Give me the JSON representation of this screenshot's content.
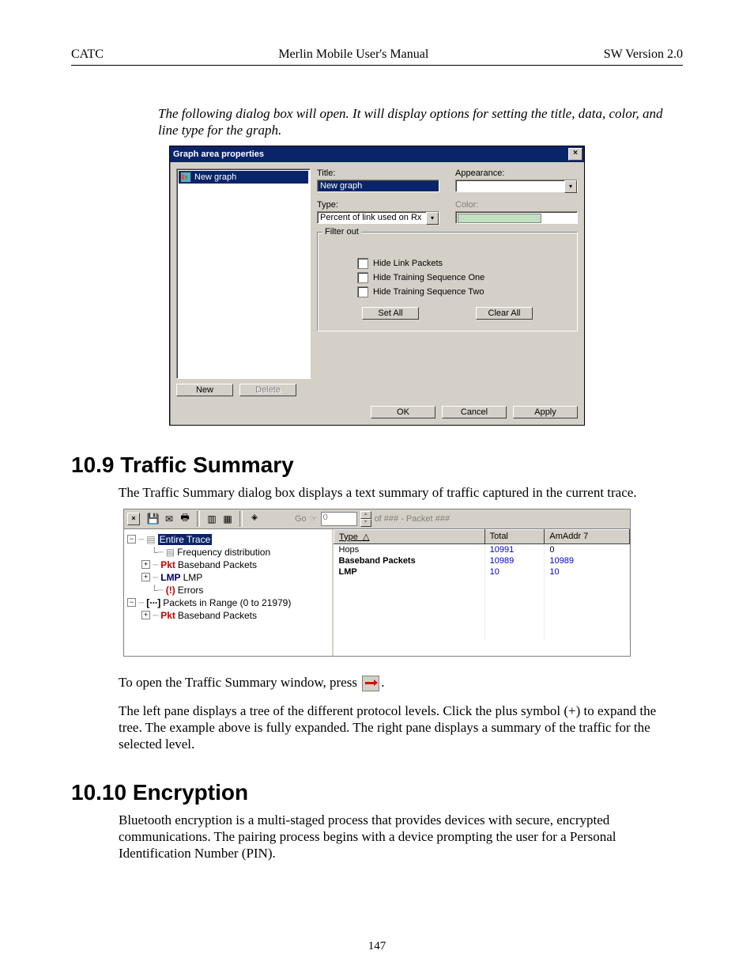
{
  "header": {
    "left": "CATC",
    "center": "Merlin Mobile User's Manual",
    "right": "SW Version 2.0"
  },
  "intro": "The following dialog box will open.  It will display options for setting the title, data, color, and line type for the graph.",
  "dlg1": {
    "title": "Graph area properties",
    "listItem": "New graph",
    "newBtn": "New",
    "deleteBtn": "Delete",
    "titleLbl": "Title:",
    "titleVal": "New graph",
    "appearanceLbl": "Appearance:",
    "typeLbl": "Type:",
    "typeVal": "Percent of link used on Rx",
    "colorLbl": "Color:",
    "filterLbl": "Filter out",
    "chk1": "Hide Link Packets",
    "chk2": "Hide Training Sequence One",
    "chk3": "Hide Training Sequence Two",
    "setAll": "Set All",
    "clearAll": "Clear All",
    "ok": "OK",
    "cancel": "Cancel",
    "apply": "Apply"
  },
  "sec1": {
    "heading": "10.9  Traffic Summary",
    "p1": "The Traffic Summary dialog box displays a text summary of traffic captured in the current trace."
  },
  "dlg2": {
    "go": "Go",
    "goVal": "0",
    "goRight": "of ### - Packet ###",
    "col1": "Type",
    "col2": "Total",
    "col3": "AmAddr 7",
    "rows": [
      {
        "type": "Hops",
        "total": "10991",
        "am": "0",
        "bold": false
      },
      {
        "type": "Baseband Packets",
        "total": "10989",
        "am": "10989",
        "bold": true
      },
      {
        "type": "LMP",
        "total": "10",
        "am": "10",
        "bold": true
      }
    ],
    "tree": {
      "root": "Entire Trace",
      "freq": "Frequency distribution",
      "bbp": "Baseband Packets",
      "lmp": "LMP",
      "err": "Errors",
      "range": "Packets in Range (0 to 21979)",
      "bbp2": "Baseband Packets",
      "pktTag": "Pkt",
      "lmpTag": "LMP",
      "rangeTag": "[∙∙∙]"
    }
  },
  "afterDlg2": {
    "p1a": "To open the Traffic Summary window, press ",
    "p1b": ".",
    "p2": "The left pane displays a tree of the different protocol levels.  Click the plus symbol (+) to expand the tree.  The example above is fully expanded.  The right pane displays a summary of the traffic for the selected level."
  },
  "sec2": {
    "heading": "10.10  Encryption",
    "p1": "Bluetooth encryption is a multi-staged process that provides devices with secure, encrypted communications.  The pairing process begins with a device prompting the user for a Personal Identification Number (PIN)."
  },
  "pageNumber": "147"
}
